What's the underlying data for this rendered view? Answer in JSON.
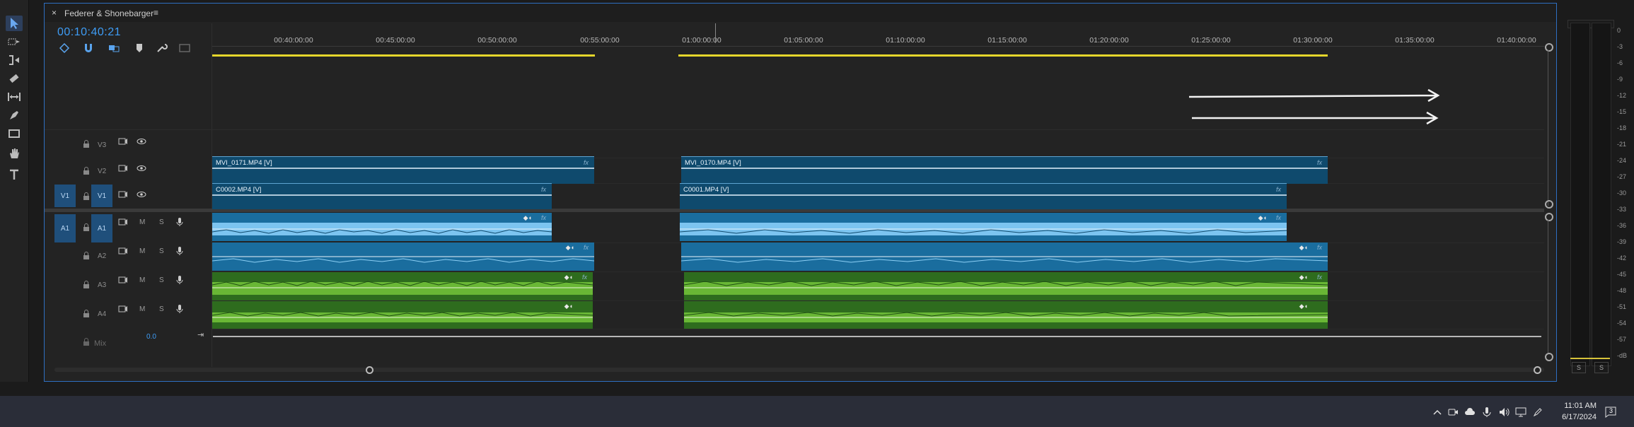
{
  "panel": {
    "close_glyph": "×",
    "title": "Federer & Shonebarger",
    "menu_glyph": "≡",
    "timecode": "00:10:40:21"
  },
  "ruler": {
    "labels": [
      "00:40:00:00",
      "00:45:00:00",
      "00:50:00:00",
      "00:55:00:00",
      "01:00:00:00",
      "01:05:00:00",
      "01:10:00:00",
      "01:15:00:00",
      "01:20:00:00",
      "01:25:00:00",
      "01:30:00:00",
      "01:35:00:00",
      "01:40:00:00"
    ]
  },
  "tracks": {
    "v3": {
      "label": "V3"
    },
    "v2": {
      "label": "V2"
    },
    "v1": {
      "label": "V1",
      "target": "V1"
    },
    "a1": {
      "label": "A1",
      "target": "A1",
      "m": "M",
      "s": "S"
    },
    "a2": {
      "label": "A2",
      "m": "M",
      "s": "S"
    },
    "a3": {
      "label": "A3",
      "m": "M",
      "s": "S"
    },
    "a4": {
      "label": "A4",
      "m": "M",
      "s": "S"
    },
    "mix": {
      "label": "Mix",
      "value": "0.0"
    }
  },
  "clips": {
    "v2_a": "MVI_0171.MP4 [V]",
    "v2_b": "MVI_0170.MP4 [V]",
    "v1_a": "C0002.MP4 [V]",
    "v1_b": "C0001.MP4 [V]",
    "fx": "fx"
  },
  "meter": {
    "scale": [
      "0",
      "-3",
      "-6",
      "-9",
      "-12",
      "-15",
      "-18",
      "-21",
      "-24",
      "-27",
      "-30",
      "-33",
      "-36",
      "-39",
      "-42",
      "-45",
      "-48",
      "-51",
      "-54",
      "-57",
      "-dB"
    ],
    "solo_left": "S",
    "solo_right": "S"
  },
  "taskbar": {
    "time": "11:01 AM",
    "date": "6/17/2024",
    "notification_count": "3"
  },
  "colors": {
    "accent": "#3e9cf5",
    "video_clip": "#0f4a6d",
    "audio_blue": "#1a6d9e",
    "audio_green": "#2e6c1e",
    "work_area": "#e5d62b"
  }
}
